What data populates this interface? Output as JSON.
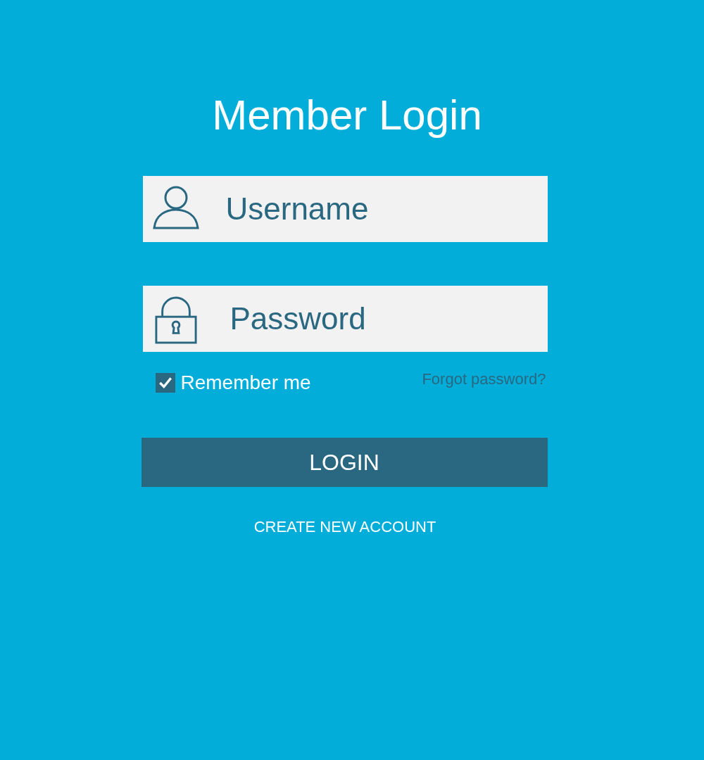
{
  "title": "Member Login",
  "fields": [
    {
      "kind": "user",
      "placeholder": "Username"
    },
    {
      "kind": "password",
      "placeholder": "Password"
    }
  ],
  "remember": {
    "label": "Remember me",
    "checked": true
  },
  "forgot_link": "Forgot password?",
  "login_button": "LOGIN",
  "create_account_link": "CREATE NEW ACCOUNT"
}
